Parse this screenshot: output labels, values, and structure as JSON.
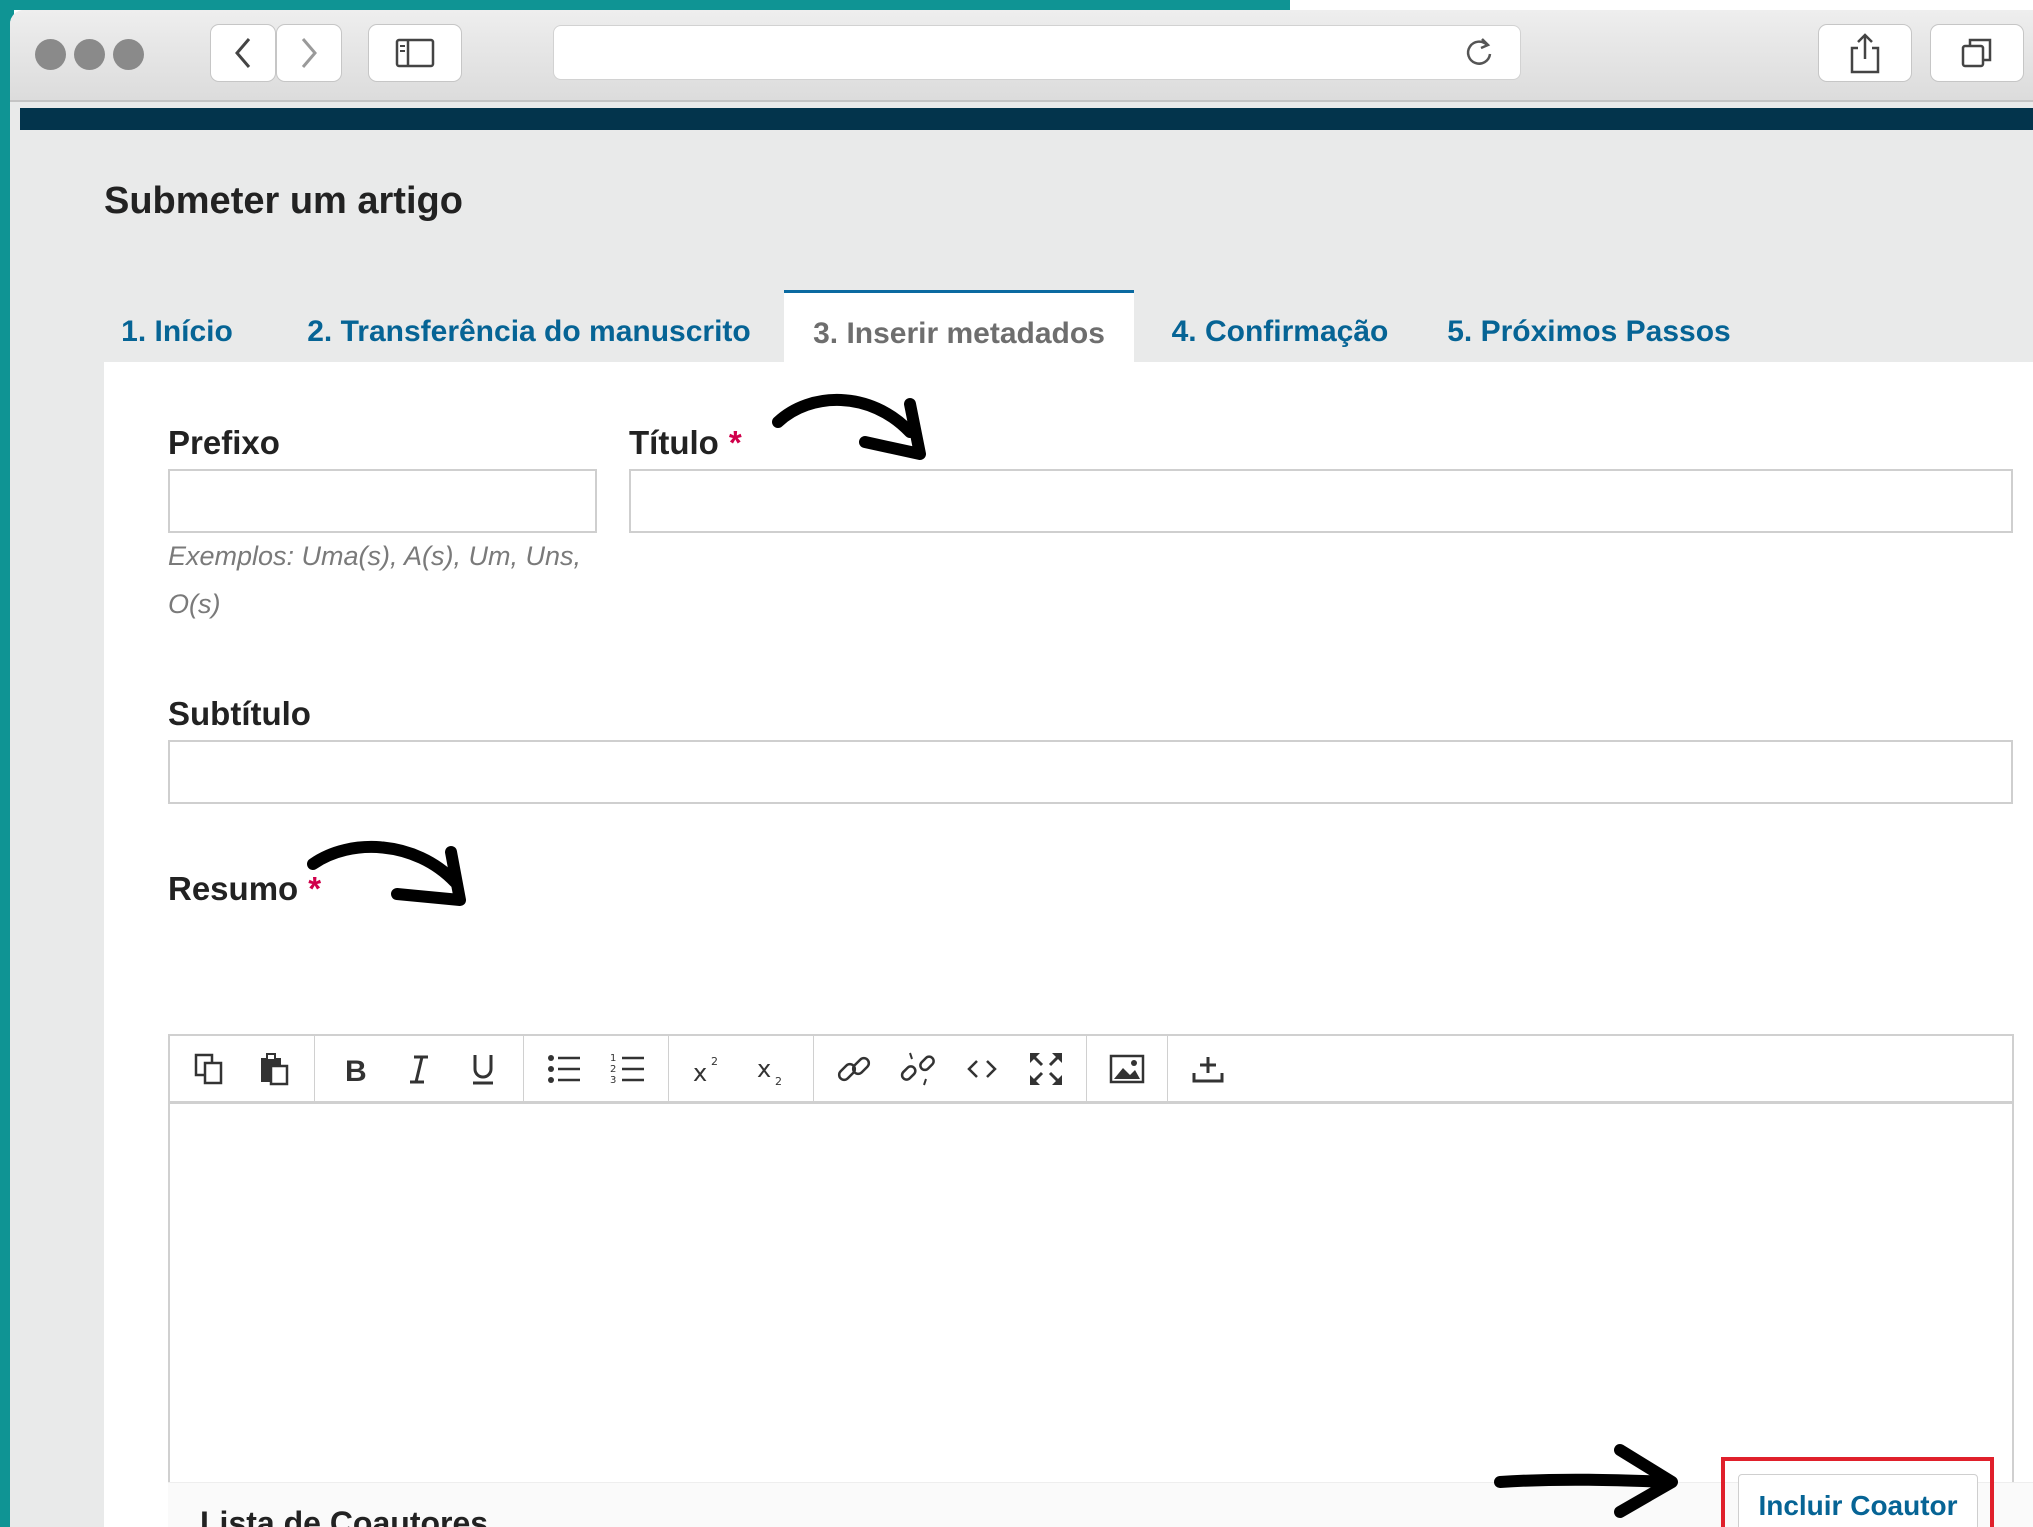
{
  "page_title": "Submeter um artigo",
  "tabs": [
    {
      "label": "1. Início",
      "active": false
    },
    {
      "label": "2. Transferência do manuscrito",
      "active": false
    },
    {
      "label": "3. Inserir metadados",
      "active": true
    },
    {
      "label": "4. Confirmação",
      "active": false
    },
    {
      "label": "5. Próximos Passos",
      "active": false
    }
  ],
  "form": {
    "prefix": {
      "label": "Prefixo",
      "value": "",
      "help": "Exemplos: Uma(s), A(s), Um, Uns, O(s)"
    },
    "title": {
      "label": "Título",
      "required_mark": "*",
      "value": ""
    },
    "subtitle": {
      "label": "Subtítulo",
      "value": ""
    },
    "abstract": {
      "label": "Resumo",
      "required_mark": "*",
      "value": ""
    }
  },
  "editor_toolbar": [
    [
      "copy-icon",
      "paste-icon"
    ],
    [
      "bold-icon",
      "italic-icon",
      "underline-icon"
    ],
    [
      "bullet-list-icon",
      "numbered-list-icon"
    ],
    [
      "superscript-icon",
      "subscript-icon"
    ],
    [
      "link-icon",
      "unlink-icon",
      "code-icon",
      "fullscreen-icon"
    ],
    [
      "image-icon"
    ],
    [
      "upload-icon"
    ]
  ],
  "coauthors": {
    "title": "Lista de Coautores",
    "add_button": "Incluir Coautor"
  },
  "colors": {
    "frame_teal": "#0f9494",
    "nav_bar": "#03344c",
    "link_blue": "#066495",
    "required_red": "#d0004b",
    "highlight_red": "#e0202b"
  }
}
